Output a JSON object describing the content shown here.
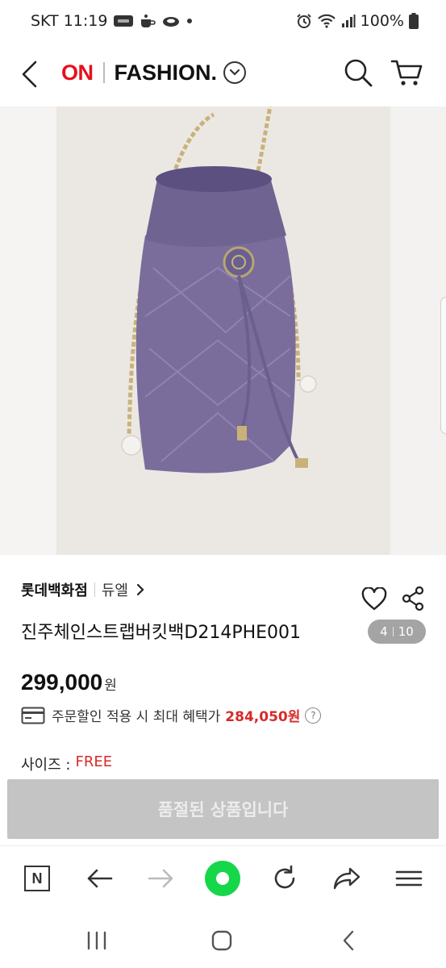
{
  "status": {
    "carrier_time": "SKT 11:19",
    "battery": "100%",
    "icons": [
      "ably-app-icon",
      "cup-icon",
      "cloud-icon",
      "dot-icon",
      "alarm-icon",
      "wifi-icon",
      "signal-icon",
      "battery-icon"
    ]
  },
  "header": {
    "logo_on": "ON",
    "logo_fashion": "FASHION.",
    "icons": [
      "back-icon",
      "chevron-down-icon",
      "search-icon",
      "cart-icon"
    ]
  },
  "gallery": {
    "current": "4",
    "total": "10"
  },
  "product": {
    "store": "롯데백화점",
    "brand": "듀엘",
    "title": "진주체인스트랩버킷백D214PHE001",
    "price": "299,000",
    "price_unit": "원",
    "benefit_label": "주문할인 적용 시 최대 혜택가",
    "benefit_price": "284,050원",
    "help": "?",
    "size_label": "사이즈 :",
    "size_value": "FREE",
    "soldout_label": "품절된 상품입니다"
  },
  "toolbar": {
    "n_label": "N",
    "icons": [
      "naver-n-icon",
      "back-arrow-icon",
      "forward-arrow-icon",
      "home-icon",
      "refresh-icon",
      "share-arrow-icon",
      "menu-icon"
    ]
  },
  "colors": {
    "brand_red": "#e5111d",
    "accent_red": "#d72a2a",
    "soldout_gray": "#c4c4c4",
    "home_green": "#16d64a",
    "bag_purple": "#7a6d9b"
  }
}
